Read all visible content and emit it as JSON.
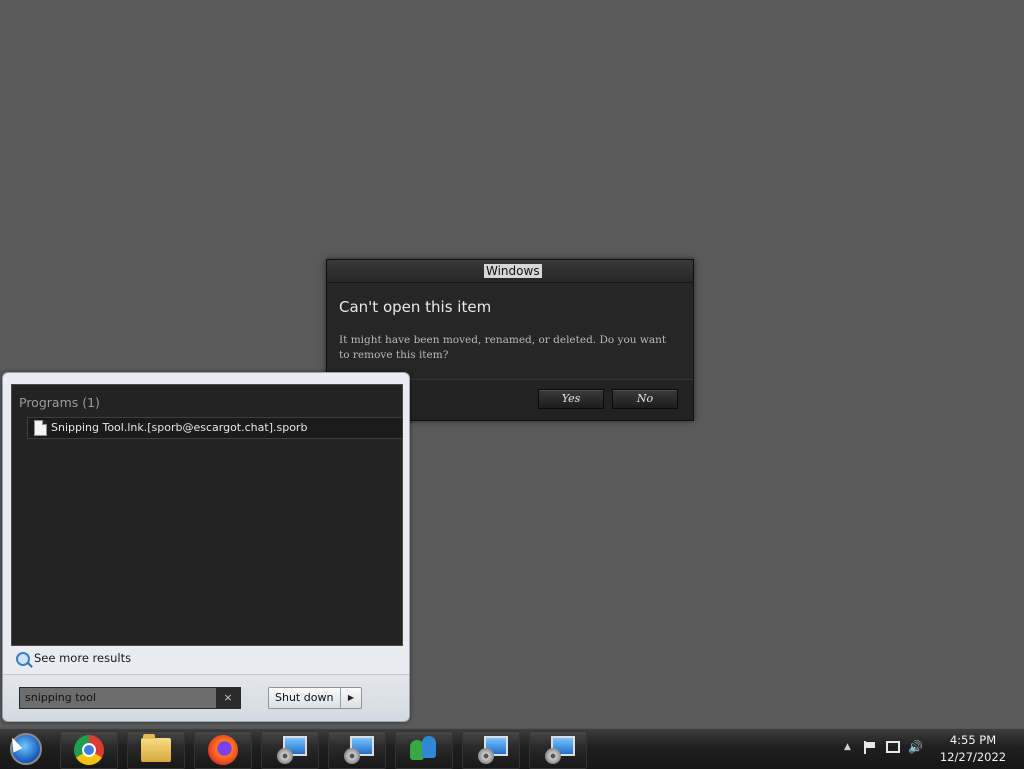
{
  "dialog": {
    "title": "Windows",
    "heading": "Can't open this item",
    "message": "It might have been moved, renamed, or deleted. Do you want to remove this item?",
    "yes_label": "Yes",
    "no_label": "No"
  },
  "start_menu": {
    "section_header": "Programs (1)",
    "results": [
      {
        "label": "Snipping Tool.lnk.[sporb@escargot.chat].sporb",
        "icon": "file-icon"
      }
    ],
    "see_more_label": "See more results",
    "search": {
      "value": "snipping tool",
      "clear_icon": "×"
    },
    "shutdown_label": "Shut down",
    "shutdown_arrow": "▶"
  },
  "taskbar": {
    "items": [
      {
        "name": "start-orb",
        "icon": "windows-orb-icon"
      },
      {
        "name": "chrome",
        "icon": "chrome-icon"
      },
      {
        "name": "file-explorer",
        "icon": "folder-icon"
      },
      {
        "name": "firefox",
        "icon": "firefox-icon"
      },
      {
        "name": "remote-desktop-1",
        "icon": "remote-desktop-icon"
      },
      {
        "name": "remote-desktop-2",
        "icon": "remote-desktop-icon"
      },
      {
        "name": "messenger",
        "icon": "messenger-icon"
      },
      {
        "name": "remote-desktop-3",
        "icon": "remote-desktop-icon"
      },
      {
        "name": "remote-desktop-4",
        "icon": "remote-desktop-icon"
      }
    ],
    "tray": {
      "arrow": "▲",
      "volume": "🔊",
      "time": "4:55 PM",
      "date": "12/27/2022"
    }
  },
  "colors": {
    "desktop": "#5a5a5a",
    "dialog_bg": "#262626",
    "results_bg": "#232323"
  }
}
